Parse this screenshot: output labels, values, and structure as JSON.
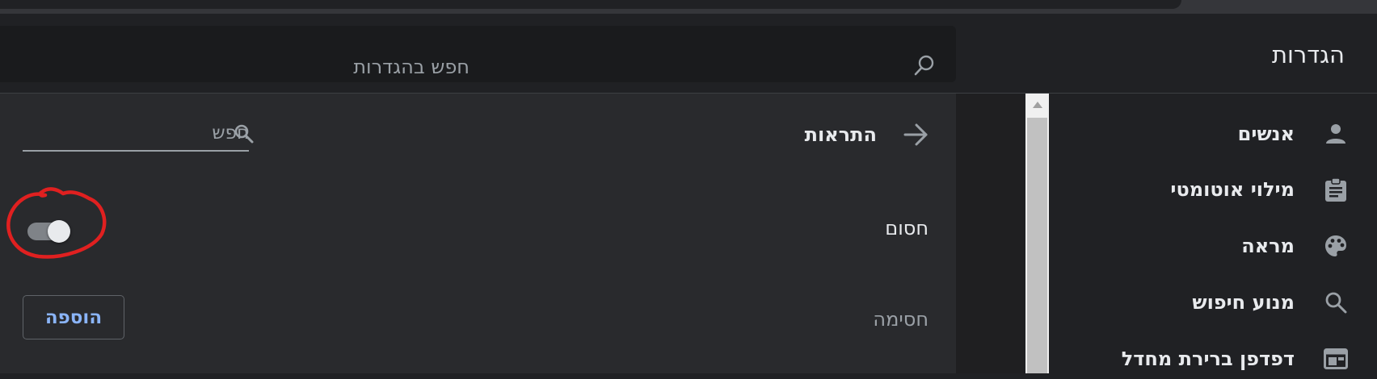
{
  "header": {
    "title": "הגדרות",
    "search_placeholder": "חפש בהגדרות"
  },
  "sidebar": {
    "items": [
      {
        "label": "אנשים",
        "icon": "person-icon"
      },
      {
        "label": "מילוי אוטומטי",
        "icon": "clipboard-icon"
      },
      {
        "label": "מראה",
        "icon": "palette-icon"
      },
      {
        "label": "מנוע חיפוש",
        "icon": "search-icon"
      },
      {
        "label": "דפדפן ברירת מחדל",
        "icon": "browser-icon"
      }
    ]
  },
  "main": {
    "page_title": "התראות",
    "list_search_placeholder": "חפש",
    "block_label": "חסום",
    "block_toggle_on": true,
    "blocked_label": "חסימה",
    "add_button_label": "הוספה"
  },
  "colors": {
    "background": "#202124",
    "panel": "#292a2d",
    "accent": "#8ab4f8",
    "annotation": "#e02020"
  }
}
